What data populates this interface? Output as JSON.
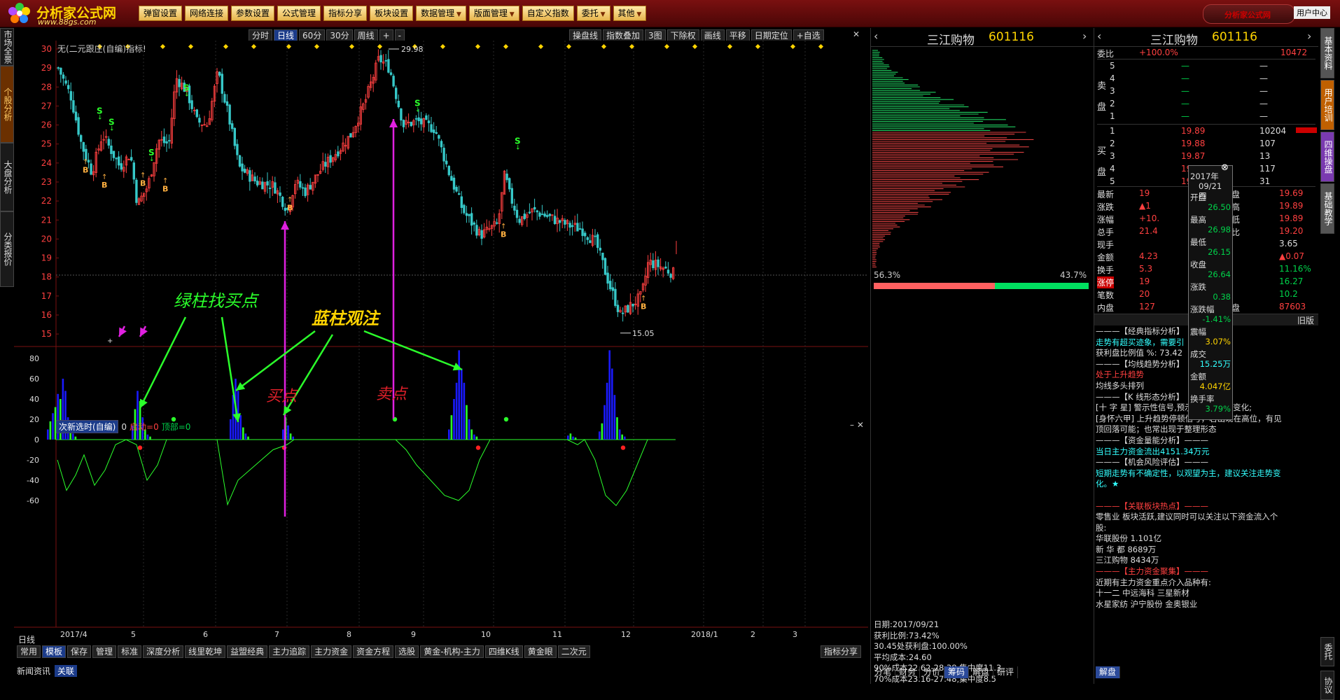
{
  "app": {
    "logo_text": "分析家公式网",
    "logo_url": "www.88gs.com",
    "user_center": "用户中心",
    "brand_text": "分析家公式网"
  },
  "menu": [
    "弹窗设置",
    "网络连接",
    "参数设置",
    "公式管理",
    "指标分享",
    "板块设置",
    "数据管理",
    "版面管理",
    "自定义指数",
    "委托",
    "其他"
  ],
  "left_tabs": [
    "市场全景",
    "个股分析",
    "大盘分析",
    "分类报价"
  ],
  "right_tabs": [
    "基本资料",
    "用户培训",
    "四维操盘",
    "基础教学"
  ],
  "right_tools": [
    "委托",
    "协议"
  ],
  "chart_toolbar": [
    "分时",
    "日线",
    "60分",
    "30分",
    "周线",
    "+",
    "-"
  ],
  "chart_toolbar_right": [
    "操盘线",
    "指数叠加",
    "3图",
    "下除权",
    "画线",
    "平移",
    "日期定位",
    "+自选"
  ],
  "indicator_title": "无(二元跟庄(自编)指标!",
  "price_axis": [
    "30",
    "29",
    "28",
    "27",
    "26",
    "25",
    "24",
    "23",
    "22",
    "21",
    "20",
    "19",
    "18",
    "17",
    "16",
    "15"
  ],
  "annotations": {
    "high": "29.98",
    "low": "15.05",
    "green_bar": "绿柱找买点",
    "blue_bar": "蓝柱观注",
    "buy": "买点",
    "sell": "卖点",
    "marker_B": "B",
    "marker_S": "S"
  },
  "sub_panel": {
    "select": "次新选时(自编)",
    "text1": "0",
    "start_label": "启动=0",
    "top_label": "顶部=0"
  },
  "sub_axis": [
    "80",
    "60",
    "40",
    "20",
    "0",
    "-20",
    "-40",
    "-60"
  ],
  "x_axis": {
    "period": "日线",
    "labels": [
      "2017/4",
      "5",
      "6",
      "7",
      "8",
      "9",
      "10",
      "11",
      "12",
      "2018/1",
      "2",
      "3"
    ]
  },
  "bottom_tabs": [
    "常用",
    "模板",
    "保存",
    "管理",
    "标准",
    "深度分析",
    "线里乾坤",
    "益盟经典",
    "主力追踪",
    "主力资金",
    "资金方程",
    "选股",
    "黄金-机构-主力",
    "四维K线",
    "黄金眼",
    "二次元"
  ],
  "bottom_share": "指标分享",
  "status": [
    "新闻资讯",
    "关联"
  ],
  "chip": {
    "stock": "三江购物",
    "code": "601116",
    "pct_left": "56.3%",
    "pct_right": "43.7%",
    "info": [
      "日期:2017/09/21",
      "获利比例:73.42%",
      "30.45处获利盘:100.00%",
      "平均成本:24.60",
      "90%成本22.62-28.38,集中度11.3",
      "70%成本23.16-27.48,集中度8.5"
    ],
    "tabs": [
      "分笔",
      "财务",
      "分价",
      "筹码",
      "解盘",
      "研评"
    ]
  },
  "quote": {
    "stock": "三江购物",
    "code": "601116",
    "weibi": {
      "label": "委比",
      "pct": "+100.0%",
      "val": "10472"
    },
    "sell": [
      [
        "5",
        "—",
        "—"
      ],
      [
        "4",
        "—",
        "—"
      ],
      [
        "3",
        "—",
        "—"
      ],
      [
        "2",
        "—",
        "—"
      ],
      [
        "1",
        "—",
        "—"
      ]
    ],
    "buy": [
      [
        "1",
        "19.89",
        "10204"
      ],
      [
        "2",
        "19.88",
        "107"
      ],
      [
        "3",
        "19.87",
        "13"
      ],
      [
        "4",
        "19.86",
        "117"
      ],
      [
        "5",
        "19.85",
        "31"
      ]
    ],
    "side_sell": "卖盘",
    "side_buy": "买盘",
    "stats": [
      [
        "最新",
        "19",
        "开盘",
        "19.69"
      ],
      [
        "涨跌",
        "▲1",
        "最高",
        "19.89"
      ],
      [
        "涨幅",
        "+10.",
        "最低",
        "19.89"
      ],
      [
        "总手",
        "21.4",
        "量比",
        "19.20"
      ],
      [
        "现手",
        "",
        "",
        "3.65"
      ],
      [
        "金额",
        "4.23",
        "",
        "▲0.07"
      ],
      [
        "换手",
        "5.3",
        "",
        "11.16%"
      ],
      [
        "涨停",
        "19",
        "",
        "16.27"
      ],
      [
        "笔数",
        "20",
        "",
        "10.2"
      ],
      [
        "内盘",
        "127",
        "外盘",
        "87603"
      ]
    ],
    "old_version": "旧版"
  },
  "tooltip": {
    "year": "2017年",
    "date": "09/21 四",
    "rows": [
      [
        "开盘",
        "26.50"
      ],
      [
        "最高",
        "26.98"
      ],
      [
        "最低",
        "26.15"
      ],
      [
        "收盘",
        "26.64"
      ],
      [
        "涨跌",
        "0.38"
      ],
      [
        "涨跌幅",
        "-1.41%"
      ],
      [
        "震幅",
        "3.07%"
      ],
      [
        "成交",
        "15.25万"
      ],
      [
        "金额",
        "4.047亿"
      ],
      [
        "换手率",
        "3.79%"
      ]
    ]
  },
  "news": {
    "lines": [
      {
        "t": "———【经典指标分析】",
        "c": "wht"
      },
      {
        "t": "走势有超买迹象，需要引",
        "c": "cyn"
      },
      {
        "t": "获利盘比例值 %: 73.42",
        "c": "wht"
      },
      {
        "t": "———【均线趋势分析】",
        "c": "wht"
      },
      {
        "t": "处于上升趋势",
        "c": "red"
      },
      {
        "t": "均线多头排列",
        "c": "wht"
      },
      {
        "t": "———【K 线形态分析】",
        "c": "wht"
      },
      {
        "t": "[十 字 星] 警示性信号,预示可能停顿或变化;",
        "c": "wht"
      },
      {
        "t": "[身怀六甲] 上升趋势停顿信号，若出现在高位，有见",
        "c": "wht"
      },
      {
        "t": "顶回落可能；也常出现于整理形态",
        "c": "wht"
      },
      {
        "t": "———【资金量能分析】———",
        "c": "wht"
      },
      {
        "t": "当日主力资金流出4151.34万元",
        "c": "cyn"
      },
      {
        "t": "———【机会风险评估】———",
        "c": "wht"
      },
      {
        "t": "短期走势有不确定性，以观望为主，建议关注走势变",
        "c": "cyn"
      },
      {
        "t": "化。★",
        "c": "cyn"
      },
      {
        "t": "",
        "c": "wht"
      },
      {
        "t": "———【关联板块热点】———",
        "c": "red"
      },
      {
        "t": "零售业 板块活跃,建议同时可以关注以下资金流入个",
        "c": "wht"
      },
      {
        "t": "股:",
        "c": "wht"
      },
      {
        "t": "华联股份 1.101亿",
        "c": "wht"
      },
      {
        "t": "新 华 都 8689万",
        "c": "wht"
      },
      {
        "t": "三江购物 8434万",
        "c": "wht"
      },
      {
        "t": "———【主力资金聚集】———",
        "c": "red"
      },
      {
        "t": "近期有主力资金重点介入品种有:",
        "c": "wht"
      },
      {
        "t": "十一二 中远海科 三星新材",
        "c": "wht"
      },
      {
        "t": "水星家纺 沪宁股份 金奥银业",
        "c": "wht"
      }
    ],
    "tab": "解盘"
  },
  "colors": {
    "up": "#ff4040",
    "down": "#36c8c8",
    "green_sig": "#2bff2b",
    "blue_bar": "#1a1aff",
    "magenta": "#e020e0"
  }
}
